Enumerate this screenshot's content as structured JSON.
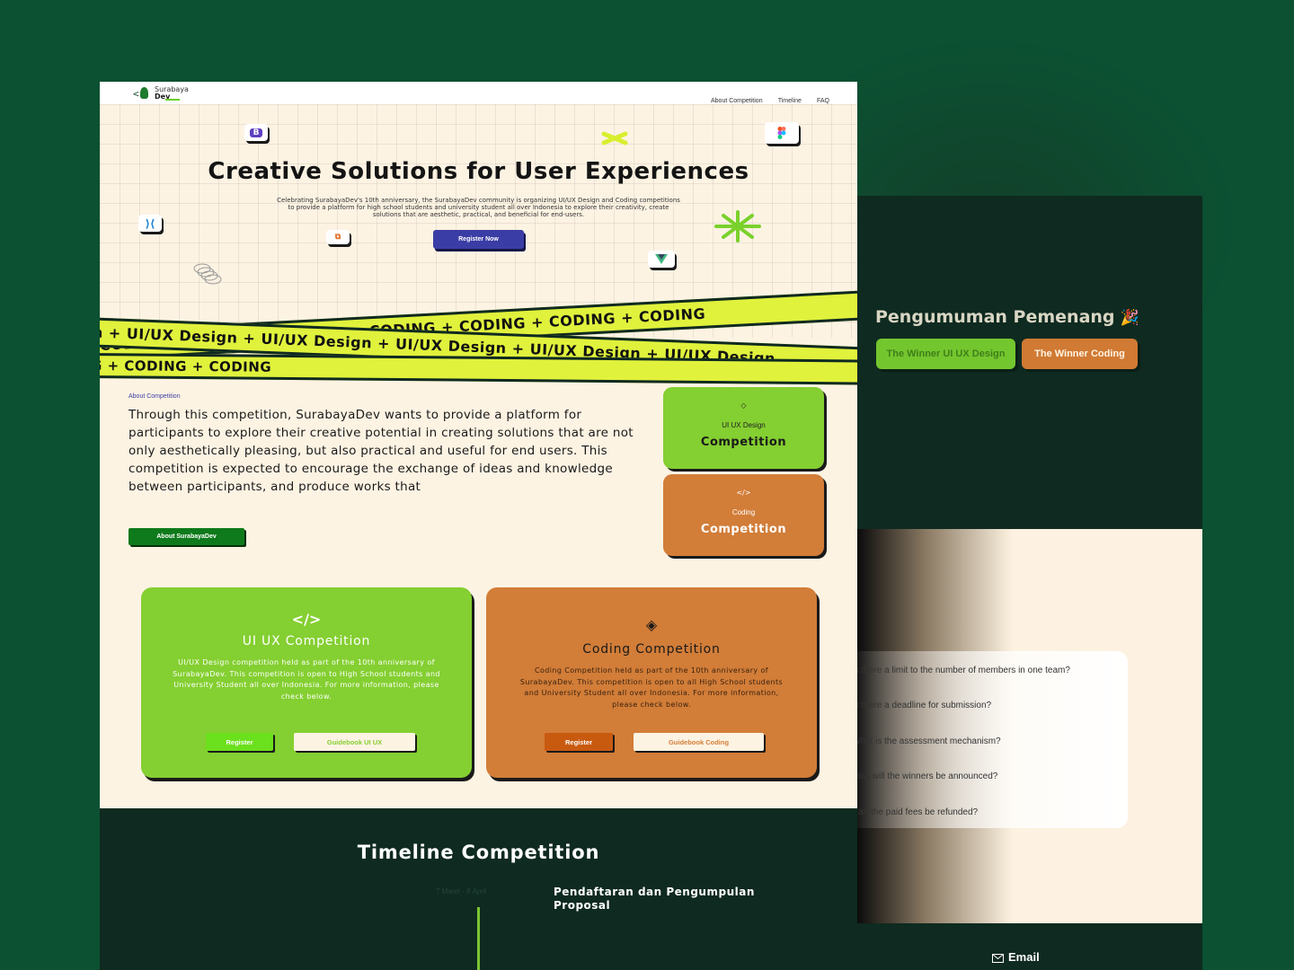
{
  "nav": {
    "brand_top": "Surabaya",
    "brand_bottom": "Dev",
    "links": [
      "About Competition",
      "Timeline",
      "FAQ"
    ]
  },
  "hero": {
    "title": "Creative Solutions for User Experiences",
    "description": "Celebrating SurabayaDev's 10th anniversary, the SurabayaDev community is organizing UI/UX Design and Coding competitions to provide a platform for high school students and university student all over Indonesia to explore their creativity, create solutions that are aesthetic, practical, and beneficial for end-users.",
    "register_label": "Register Now",
    "icons": [
      "bootstrap-icon",
      "figma-icon",
      "vscode-icon",
      "laravel-icon",
      "vue-icon",
      "spring-coil-icon",
      "sparkle-icon",
      "cross-shape-icon"
    ]
  },
  "ribbons": {
    "r1": "gn  + UI/UX Design  + UI/UX Design  + UI/UX Design  + UI/UX Design  + UI/UX Design",
    "r2": "+ CODING  + CODING  + CODING  + CODING  + CODING  + CODING  + CODING",
    "r3": "G  + CODING  + CODING"
  },
  "about": {
    "label": "About Competition",
    "text": "Through this competition, SurabayaDev wants to provide a platform for participants to explore their creative potential in creating solutions that are not only aesthetically pleasing, but also practical and useful for end users. This competition is expected to encourage the exchange of ideas and knowledge between participants, and produce works that",
    "button": "About SurabayaDev",
    "cards": [
      {
        "icon": "◇",
        "sub": "UI UX Design",
        "main": "Competition"
      },
      {
        "icon": "</>",
        "sub": "Coding",
        "main": "Competition"
      }
    ]
  },
  "competitions": [
    {
      "icon": "</>",
      "title": "UI UX Competition",
      "description": "UI/UX Design competition held as part of the 10th anniversary of SurabayaDev. This competition is open to High School students and University Student all over Indonesia. For more information, please check below.",
      "register": "Register",
      "guidebook": "Guidebook UI UX"
    },
    {
      "icon": "◈",
      "title": "Coding Competition",
      "description": "Coding Competition held as part of the 10th anniversary of SurabayaDev. This competition is open to all High School students and University Student all over Indonesia. For more information, please check below.",
      "register": "Register",
      "guidebook": "Guidebook Coding"
    }
  ],
  "timeline": {
    "title": "Timeline Competition",
    "date": "7 Maret - 8 April",
    "event": "Pendaftaran dan Pengumpulan Proposal"
  },
  "winners": {
    "title": "Pengumuman Pemenang",
    "emoji": "🎉",
    "uiux_button": "The Winner UI UX Design",
    "coding_button": "The Winner Coding"
  },
  "faq": [
    "Is there a limit to the number of members in one team?",
    "Is there a deadline for submission?",
    "What is the assessment mechanism?",
    "How will the winners be announced?",
    "Can the paid fees be refunded?"
  ],
  "footer": {
    "email_label": "Email"
  },
  "colors": {
    "background": "#0b5132",
    "dark": "#0f2a20",
    "cream": "#fdf3e3",
    "green": "#84cf31",
    "orange": "#d27d38",
    "ribbon": "#e0f23c",
    "primary": "#3b3da6"
  }
}
